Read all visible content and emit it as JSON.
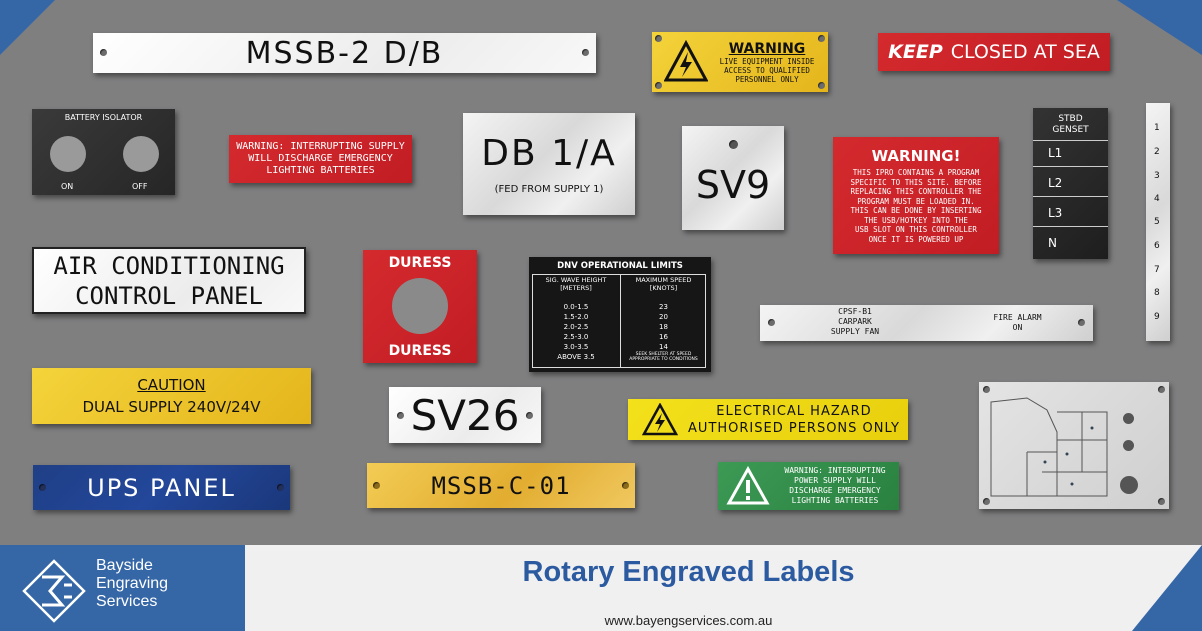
{
  "colors": {
    "brand_blue": "#3566a6",
    "title_blue": "#2c5aa0",
    "board_grey": "#7f7f80"
  },
  "labels": {
    "mssb2": "MSSB-2 D/B",
    "warning_live": {
      "title": "WARNING",
      "lines": [
        "LIVE EQUIPMENT INSIDE",
        "ACCESS TO QUALIFIED",
        "PERSONNEL ONLY"
      ]
    },
    "keep_closed": {
      "keep": "KEEP",
      "rest": "CLOSED AT SEA"
    },
    "battery_isolator": {
      "title": "BATTERY ISOLATOR",
      "on": "ON",
      "off": "OFF"
    },
    "warning_interrupt": [
      "WARNING: INTERRUPTING SUPPLY",
      "WILL DISCHARGE EMERGENCY",
      "LIGHTING BATTERIES"
    ],
    "db1a": {
      "title": "DB 1/A",
      "sub": "(FED FROM SUPPLY 1)"
    },
    "sv9": "SV9",
    "warning_ipro": {
      "title": "WARNING!",
      "lines": [
        "THIS IPRO CONTAINS A PROGRAM",
        "SPECIFIC TO THIS SITE. BEFORE",
        "REPLACING THIS CONTROLLER THE",
        "PROGRAM MUST BE LOADED IN.",
        "THIS CAN BE DONE BY INSERTING",
        "THE USB/HOTKEY INTO THE",
        "USB SLOT ON THIS CONTROLLER",
        "ONCE IT IS POWERED UP"
      ]
    },
    "stbd_genset": {
      "title": [
        "STBD",
        "GENSET"
      ],
      "items": [
        "L1",
        "L2",
        "L3",
        "N"
      ]
    },
    "scale": [
      "1",
      "2",
      "3",
      "4",
      "5",
      "6",
      "7",
      "8",
      "9"
    ],
    "air_con": [
      "AIR CONDITIONING",
      "CONTROL PANEL"
    ],
    "duress": {
      "top": "DURESS",
      "bottom": "DURESS"
    },
    "dnv": {
      "title": "DNV OPERATIONAL LIMITS",
      "col1_header": [
        "SIG. WAVE HEIGHT",
        "[METERS]"
      ],
      "col2_header": [
        "MAXIMUM SPEED",
        "[KNOTS]"
      ],
      "rows": [
        [
          "0.0-1.5",
          "23"
        ],
        [
          "1.5-2.0",
          "20"
        ],
        [
          "2.0-2.5",
          "18"
        ],
        [
          "2.5-3.0",
          "16"
        ],
        [
          "3.0-3.5",
          "14"
        ]
      ],
      "last_left": "ABOVE 3.5",
      "last_right": [
        "SEEK SHELTER AT SPEED",
        "APPROPRIATE TO CONDITIONS"
      ]
    },
    "cpsf": {
      "left": [
        "CPSF-B1",
        "CARPARK",
        "SUPPLY FAN"
      ],
      "right": [
        "FIRE ALARM",
        "ON"
      ]
    },
    "caution": {
      "title": "CAUTION",
      "sub": "DUAL SUPPLY 240V/24V"
    },
    "sv26": "SV26",
    "elec_hazard": [
      "ELECTRICAL HAZARD",
      "AUTHORISED PERSONS ONLY"
    ],
    "ups": "UPS PANEL",
    "mssbc": "MSSB-C-01",
    "green_warning": [
      "WARNING: INTERRUPTING",
      "POWER SUPPLY WILL",
      "DISCHARGE EMERGENCY",
      "LIGHTING BATTERIES"
    ]
  },
  "footer": {
    "company": [
      "Bayside",
      "Engraving",
      "Services"
    ],
    "title": "Rotary Engraved Labels",
    "url": "www.bayengservices.com.au"
  }
}
